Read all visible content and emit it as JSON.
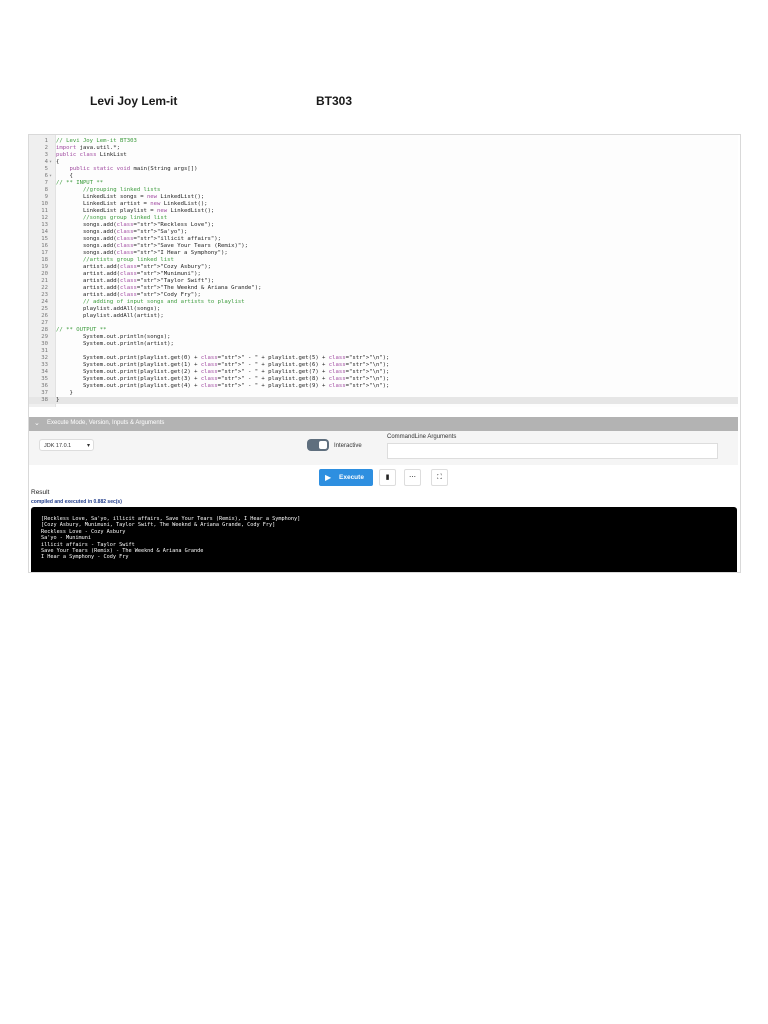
{
  "header": {
    "name": "Levi Joy Lem-it",
    "section": "BT303"
  },
  "code_lines": [
    "// Levi Joy Lem-it BT303",
    "import java.util.*;",
    "public class LinkList",
    "{",
    "    public static void main(String args[])",
    "    {",
    "// ** INPUT **",
    "        //grouping linked lists",
    "        LinkedList songs = new LinkedList();",
    "        LinkedList artist = new LinkedList();",
    "        LinkedList playlist = new LinkedList();",
    "        //songs group linked list",
    "        songs.add(\"Reckless Love\");",
    "        songs.add(\"Sa'yo\");",
    "        songs.add(\"illicit affairs\");",
    "        songs.add(\"Save Your Tears (Remix)\");",
    "        songs.add(\"I Hear a Symphony\");",
    "        //artists group linked list",
    "        artist.add(\"Cozy Asbury\");",
    "        artist.add(\"Munimuni\");",
    "        artist.add(\"Taylor Swift\");",
    "        artist.add(\"The Weeknd & Ariana Grande\");",
    "        artist.add(\"Cody Fry\");",
    "        // adding of input songs and artists to playlist",
    "        playlist.addAll(songs);",
    "        playlist.addAll(artist);",
    "",
    "// ** OUTPUT **",
    "        System.out.println(songs);",
    "        System.out.println(artist);",
    "",
    "        System.out.print(playlist.get(0) + \" - \" + playlist.get(5) + \"\\n\");",
    "        System.out.print(playlist.get(1) + \" - \" + playlist.get(6) + \"\\n\");",
    "        System.out.print(playlist.get(2) + \" - \" + playlist.get(7) + \"\\n\");",
    "        System.out.print(playlist.get(3) + \" - \" + playlist.get(8) + \"\\n\");",
    "        System.out.print(playlist.get(4) + \" - \" + playlist.get(9) + \"\\n\");",
    "    }",
    "}"
  ],
  "controls": {
    "section_title": "Execute Mode, Version, Inputs & Arguments",
    "jdk_version": "JDK 17.0.1",
    "interactive_label": "Interactive",
    "cmd_args_label": "CommandLine Arguments",
    "cmd_args_value": "",
    "execute_label": "Execute"
  },
  "result": {
    "label": "Result",
    "status": "compiled and executed in 0.882 sec(s)",
    "output": [
      "[Reckless Love, Sa'yo, illicit affairs, Save Your Tears (Remix), I Hear a Symphony]",
      "[Cozy Asbury, Munimuni, Taylor Swift, The Weeknd & Ariana Grande, Cody Fry]",
      "Reckless Love - Cozy Asbury",
      "Sa'yo - Munimuni",
      "illicit affairs - Taylor Swift",
      "Save Your Tears (Remix) - The Weeknd & Ariana Grande",
      "I Hear a Symphony - Cody Fry"
    ]
  },
  "colors": {
    "execute_button": "#2e8fe0",
    "console_bg": "#000000",
    "comment": "#3a9a3a",
    "keyword": "#a04aa0",
    "string": "#c0392b",
    "status_text": "#1f3b8a"
  },
  "icons": [
    "play-icon",
    "save-icon",
    "more-icon",
    "fullscreen-icon",
    "chevron-down-icon"
  ]
}
